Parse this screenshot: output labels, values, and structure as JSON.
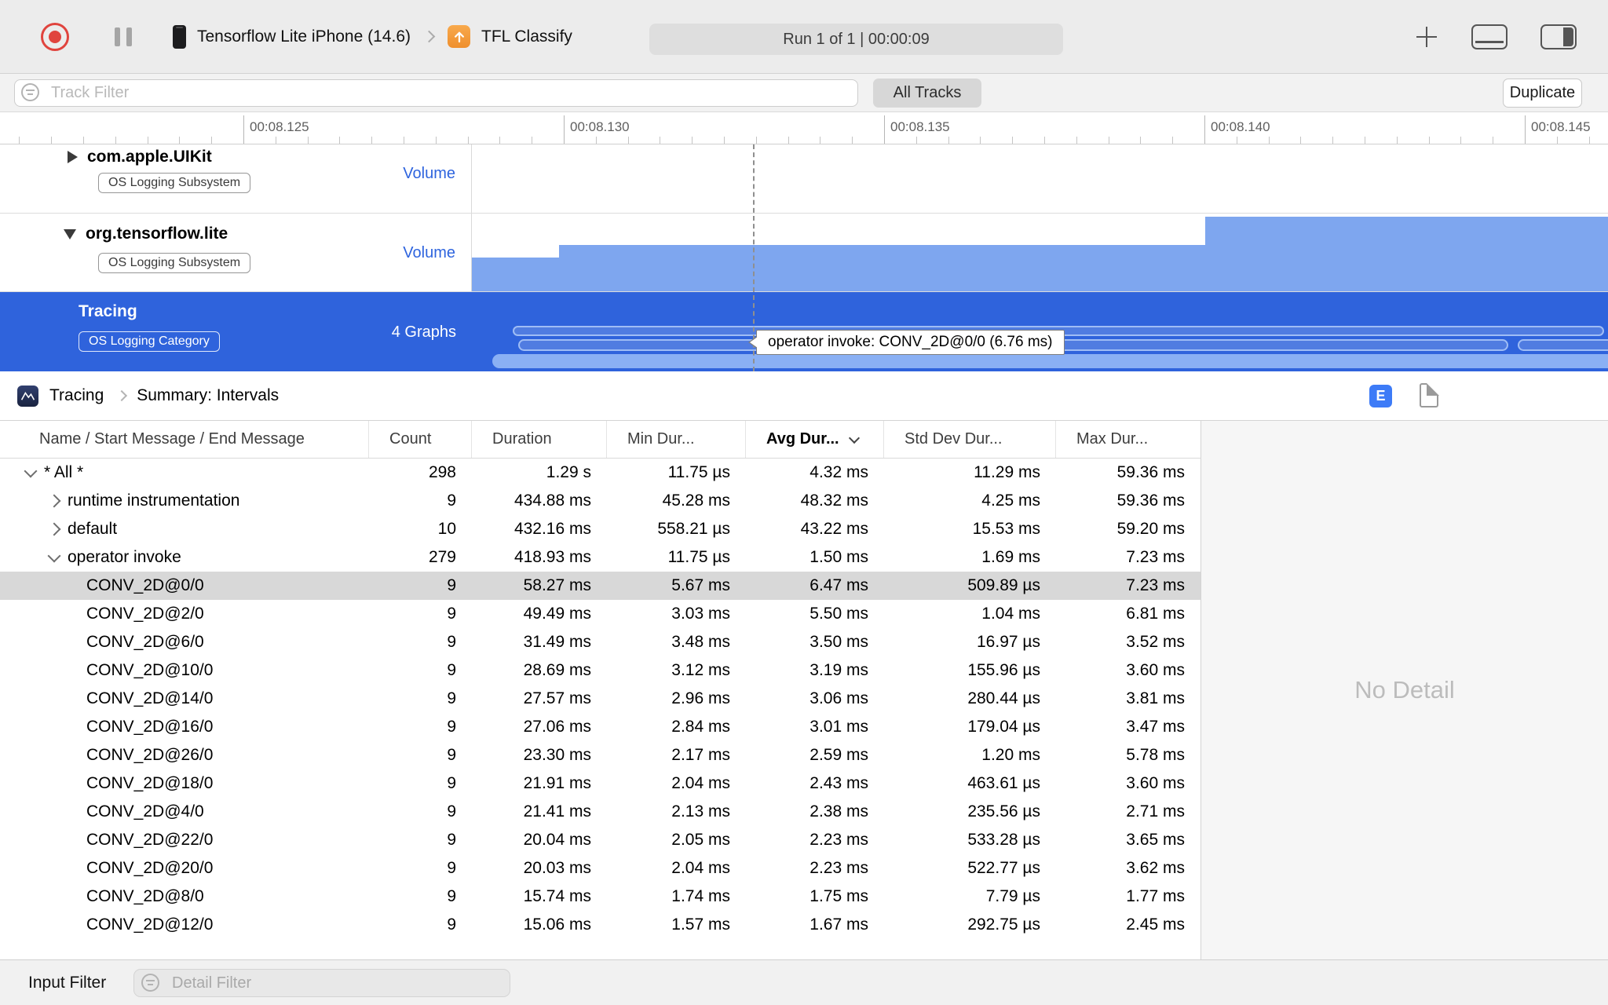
{
  "toolbar": {
    "device": "Tensorflow Lite iPhone (14.6)",
    "target": "TFL Classify",
    "status": "Run 1 of 1  |  00:00:09"
  },
  "filter_bar": {
    "track_filter_placeholder": "Track Filter",
    "all_tracks": "All Tracks",
    "duplicate": "Duplicate"
  },
  "ruler": {
    "labels": [
      "00:08.125",
      "00:08.130",
      "00:08.135",
      "00:08.140",
      "00:08.145"
    ]
  },
  "tracks": [
    {
      "name": "com.apple.UIKit",
      "badge": "OS Logging Subsystem",
      "meta": "Volume",
      "selected": false
    },
    {
      "name": "org.tensorflow.lite",
      "badge": "OS Logging Subsystem",
      "meta": "Volume",
      "selected": false
    },
    {
      "name": "Tracing",
      "badge": "OS Logging Category",
      "meta": "4 Graphs",
      "selected": true
    }
  ],
  "timeline": {
    "tooltip": "operator invoke: CONV_2D@0/0 (6.76 ms)"
  },
  "breadcrumb": {
    "instrument": "Tracing",
    "page": "Summary: Intervals",
    "e_label": "E"
  },
  "table": {
    "columns": [
      {
        "label": "Name / Start Message / End Message",
        "sorted": false
      },
      {
        "label": "Count",
        "sorted": false
      },
      {
        "label": "Duration",
        "sorted": false
      },
      {
        "label": "Min Dur...",
        "sorted": false
      },
      {
        "label": "Avg Dur...",
        "sorted": true
      },
      {
        "label": "Std Dev Dur...",
        "sorted": false
      },
      {
        "label": "Max Dur...",
        "sorted": false
      }
    ],
    "rows": [
      {
        "name": "* All *",
        "count": "298",
        "duration": "1.29 s",
        "min": "11.75 µs",
        "avg": "4.32 ms",
        "std": "11.29 ms",
        "max": "59.36 ms",
        "level": 0,
        "expand": "open",
        "selected": false
      },
      {
        "name": "runtime instrumentation",
        "count": "9",
        "duration": "434.88 ms",
        "min": "45.28 ms",
        "avg": "48.32 ms",
        "std": "4.25 ms",
        "max": "59.36 ms",
        "level": 1,
        "expand": "closed",
        "selected": false
      },
      {
        "name": "default",
        "count": "10",
        "duration": "432.16 ms",
        "min": "558.21 µs",
        "avg": "43.22 ms",
        "std": "15.53 ms",
        "max": "59.20 ms",
        "level": 1,
        "expand": "closed",
        "selected": false
      },
      {
        "name": "operator invoke",
        "count": "279",
        "duration": "418.93 ms",
        "min": "11.75 µs",
        "avg": "1.50 ms",
        "std": "1.69 ms",
        "max": "7.23 ms",
        "level": 1,
        "expand": "open",
        "selected": false
      },
      {
        "name": "CONV_2D@0/0",
        "count": "9",
        "duration": "58.27 ms",
        "min": "5.67 ms",
        "avg": "6.47 ms",
        "std": "509.89 µs",
        "max": "7.23 ms",
        "level": 2,
        "expand": "none",
        "selected": true
      },
      {
        "name": "CONV_2D@2/0",
        "count": "9",
        "duration": "49.49 ms",
        "min": "3.03 ms",
        "avg": "5.50 ms",
        "std": "1.04 ms",
        "max": "6.81 ms",
        "level": 2,
        "expand": "none",
        "selected": false
      },
      {
        "name": "CONV_2D@6/0",
        "count": "9",
        "duration": "31.49 ms",
        "min": "3.48 ms",
        "avg": "3.50 ms",
        "std": "16.97 µs",
        "max": "3.52 ms",
        "level": 2,
        "expand": "none",
        "selected": false
      },
      {
        "name": "CONV_2D@10/0",
        "count": "9",
        "duration": "28.69 ms",
        "min": "3.12 ms",
        "avg": "3.19 ms",
        "std": "155.96 µs",
        "max": "3.60 ms",
        "level": 2,
        "expand": "none",
        "selected": false
      },
      {
        "name": "CONV_2D@14/0",
        "count": "9",
        "duration": "27.57 ms",
        "min": "2.96 ms",
        "avg": "3.06 ms",
        "std": "280.44 µs",
        "max": "3.81 ms",
        "level": 2,
        "expand": "none",
        "selected": false
      },
      {
        "name": "CONV_2D@16/0",
        "count": "9",
        "duration": "27.06 ms",
        "min": "2.84 ms",
        "avg": "3.01 ms",
        "std": "179.04 µs",
        "max": "3.47 ms",
        "level": 2,
        "expand": "none",
        "selected": false
      },
      {
        "name": "CONV_2D@26/0",
        "count": "9",
        "duration": "23.30 ms",
        "min": "2.17 ms",
        "avg": "2.59 ms",
        "std": "1.20 ms",
        "max": "5.78 ms",
        "level": 2,
        "expand": "none",
        "selected": false
      },
      {
        "name": "CONV_2D@18/0",
        "count": "9",
        "duration": "21.91 ms",
        "min": "2.04 ms",
        "avg": "2.43 ms",
        "std": "463.61 µs",
        "max": "3.60 ms",
        "level": 2,
        "expand": "none",
        "selected": false
      },
      {
        "name": "CONV_2D@4/0",
        "count": "9",
        "duration": "21.41 ms",
        "min": "2.13 ms",
        "avg": "2.38 ms",
        "std": "235.56 µs",
        "max": "2.71 ms",
        "level": 2,
        "expand": "none",
        "selected": false
      },
      {
        "name": "CONV_2D@22/0",
        "count": "9",
        "duration": "20.04 ms",
        "min": "2.05 ms",
        "avg": "2.23 ms",
        "std": "533.28 µs",
        "max": "3.65 ms",
        "level": 2,
        "expand": "none",
        "selected": false
      },
      {
        "name": "CONV_2D@20/0",
        "count": "9",
        "duration": "20.03 ms",
        "min": "2.04 ms",
        "avg": "2.23 ms",
        "std": "522.77 µs",
        "max": "3.62 ms",
        "level": 2,
        "expand": "none",
        "selected": false
      },
      {
        "name": "CONV_2D@8/0",
        "count": "9",
        "duration": "15.74 ms",
        "min": "1.74 ms",
        "avg": "1.75 ms",
        "std": "7.79 µs",
        "max": "1.77 ms",
        "level": 2,
        "expand": "none",
        "selected": false
      },
      {
        "name": "CONV_2D@12/0",
        "count": "9",
        "duration": "15.06 ms",
        "min": "1.57 ms",
        "avg": "1.67 ms",
        "std": "292.75 µs",
        "max": "2.45 ms",
        "level": 2,
        "expand": "none",
        "selected": false
      }
    ]
  },
  "detail_panel": {
    "text": "No Detail"
  },
  "bottom_bar": {
    "label": "Input Filter",
    "placeholder": "Detail Filter"
  },
  "colors": {
    "selection_blue": "#2f63dc",
    "accent_blue": "#3d7bf7",
    "volume_fill": "#7ea6ef",
    "record_red": "#e0443e"
  }
}
